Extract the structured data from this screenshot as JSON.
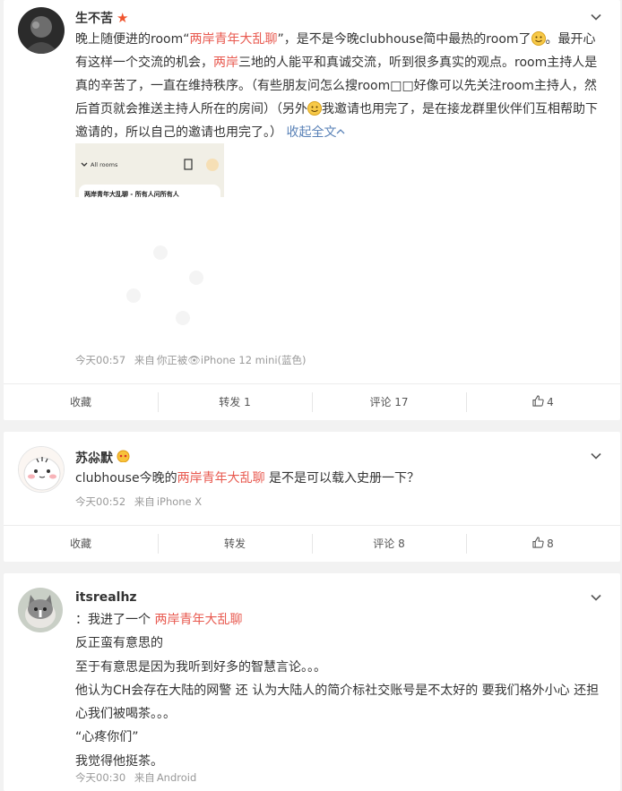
{
  "posts": [
    {
      "username": "生不苦",
      "body": {
        "p1": "晚上随便进的room“",
        "hl1": "两岸青年大乱聊",
        "p2": "”，是不是今晚clubhouse简中最热的room了",
        "p3": "。最开心有这样一个交流的机会，",
        "hl2": "两岸",
        "p4": "三地的人能平和真诚交流，听到很多真实的观点。room主持人是真的辛苦了，一直在维持秩序。（有些朋友问怎么搜room□□好像可以先关注room主持人，然后首页就会推送主持人所在的房间）（另外",
        "p5": "我邀请也用完了，是在接龙群里伙伴们互相帮助下邀请的，所以自己的邀请也用完了。）",
        "collapse": "收起全文"
      },
      "thumb": {
        "header": "All rooms",
        "room_title": "两岸青年大乱聊 - 所有人问所有人"
      },
      "meta": {
        "time": "今天00:57",
        "source_prefix": "来自",
        "source": "你正被👁iPhone 12 mini(蓝色)"
      },
      "actions": {
        "favorite": "收藏",
        "repost": "转发 1",
        "comment": "评论 17",
        "like": "4"
      }
    },
    {
      "username": "苏尛默",
      "body": {
        "p1": "clubhouse今晚的",
        "hl1": "两岸青年大乱聊",
        "p2": " 是不是可以载入史册一下？"
      },
      "meta": {
        "time": "今天00:52",
        "source_prefix": "来自",
        "source": "iPhone X"
      },
      "actions": {
        "favorite": "收藏",
        "repost": "转发",
        "comment": "评论 8",
        "like": "8"
      }
    },
    {
      "username": "itsrealhz",
      "body": {
        "l1a": "：我进了一个 ",
        "l1hl": "两岸青年大乱聊",
        "l2": "反正蛮有意思的",
        "l3": "至于有意思是因为我听到好多的智慧言论。。。",
        "l4": "他认为CH会存在大陆的网警 还 认为大陆人的简介标社交账号是不太好的 要我们格外小心 还担心我们被喝茶。。。",
        "l5": "“心疼你们”",
        "l6": "我觉得他挺茶。"
      },
      "meta": {
        "time": "今天00:30",
        "source_prefix": "来自",
        "source": "Android"
      }
    }
  ],
  "colors": {
    "highlight": "#e8594f",
    "link": "#5a82b7",
    "meta": "#999999",
    "background": "#f2f2f2"
  }
}
